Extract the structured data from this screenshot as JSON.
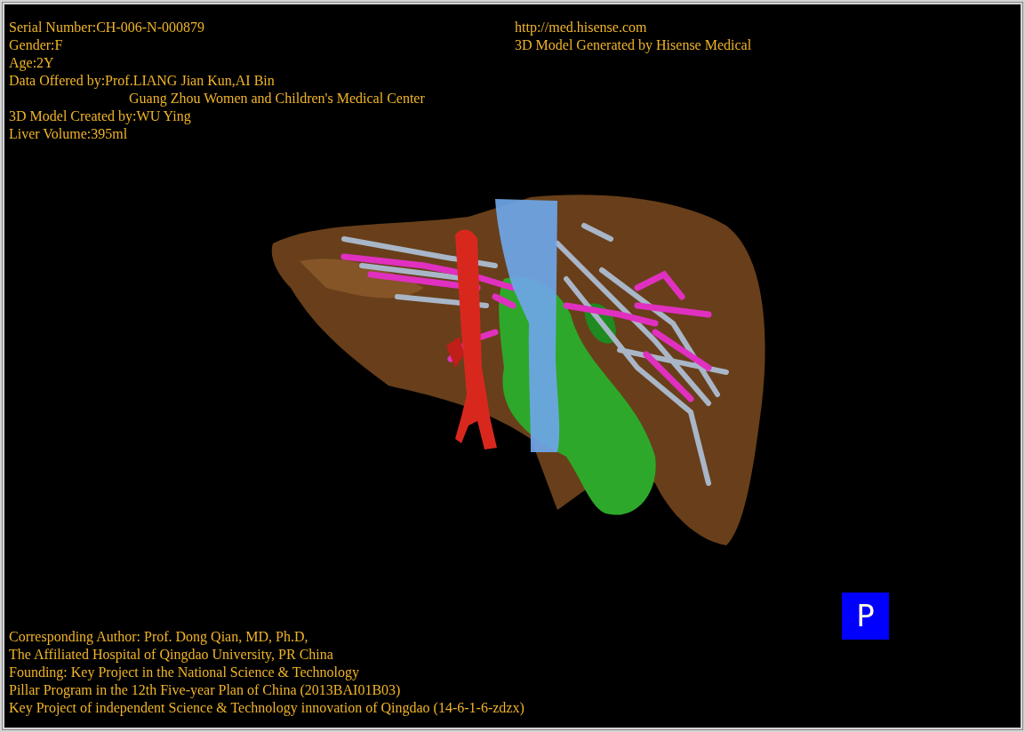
{
  "header_left": [
    "Serial Number:CH-006-N-000879",
    "Gender:F",
    "Age:2Y",
    "Data Offered by:Prof.LIANG Jian Kun,AI Bin",
    "Guang Zhou Women and Children's Medical Center",
    "3D Model Created by:WU Ying",
    "Liver Volume:395ml"
  ],
  "header_right": [
    "http://med.hisense.com",
    "3D Model Generated by Hisense Medical"
  ],
  "footer": [
    "Corresponding Author: Prof. Dong Qian, MD, Ph.D,",
    "The Affiliated Hospital of Qingdao University, PR China",
    "Founding: Key Project in the National Science & Technology",
    "Pillar Program in the 12th Five-year Plan of China (2013BAI01B03)",
    "Key Project of independent Science & Technology innovation of Qingdao (14-6-1-6-zdzx)"
  ],
  "projection_button": "P"
}
